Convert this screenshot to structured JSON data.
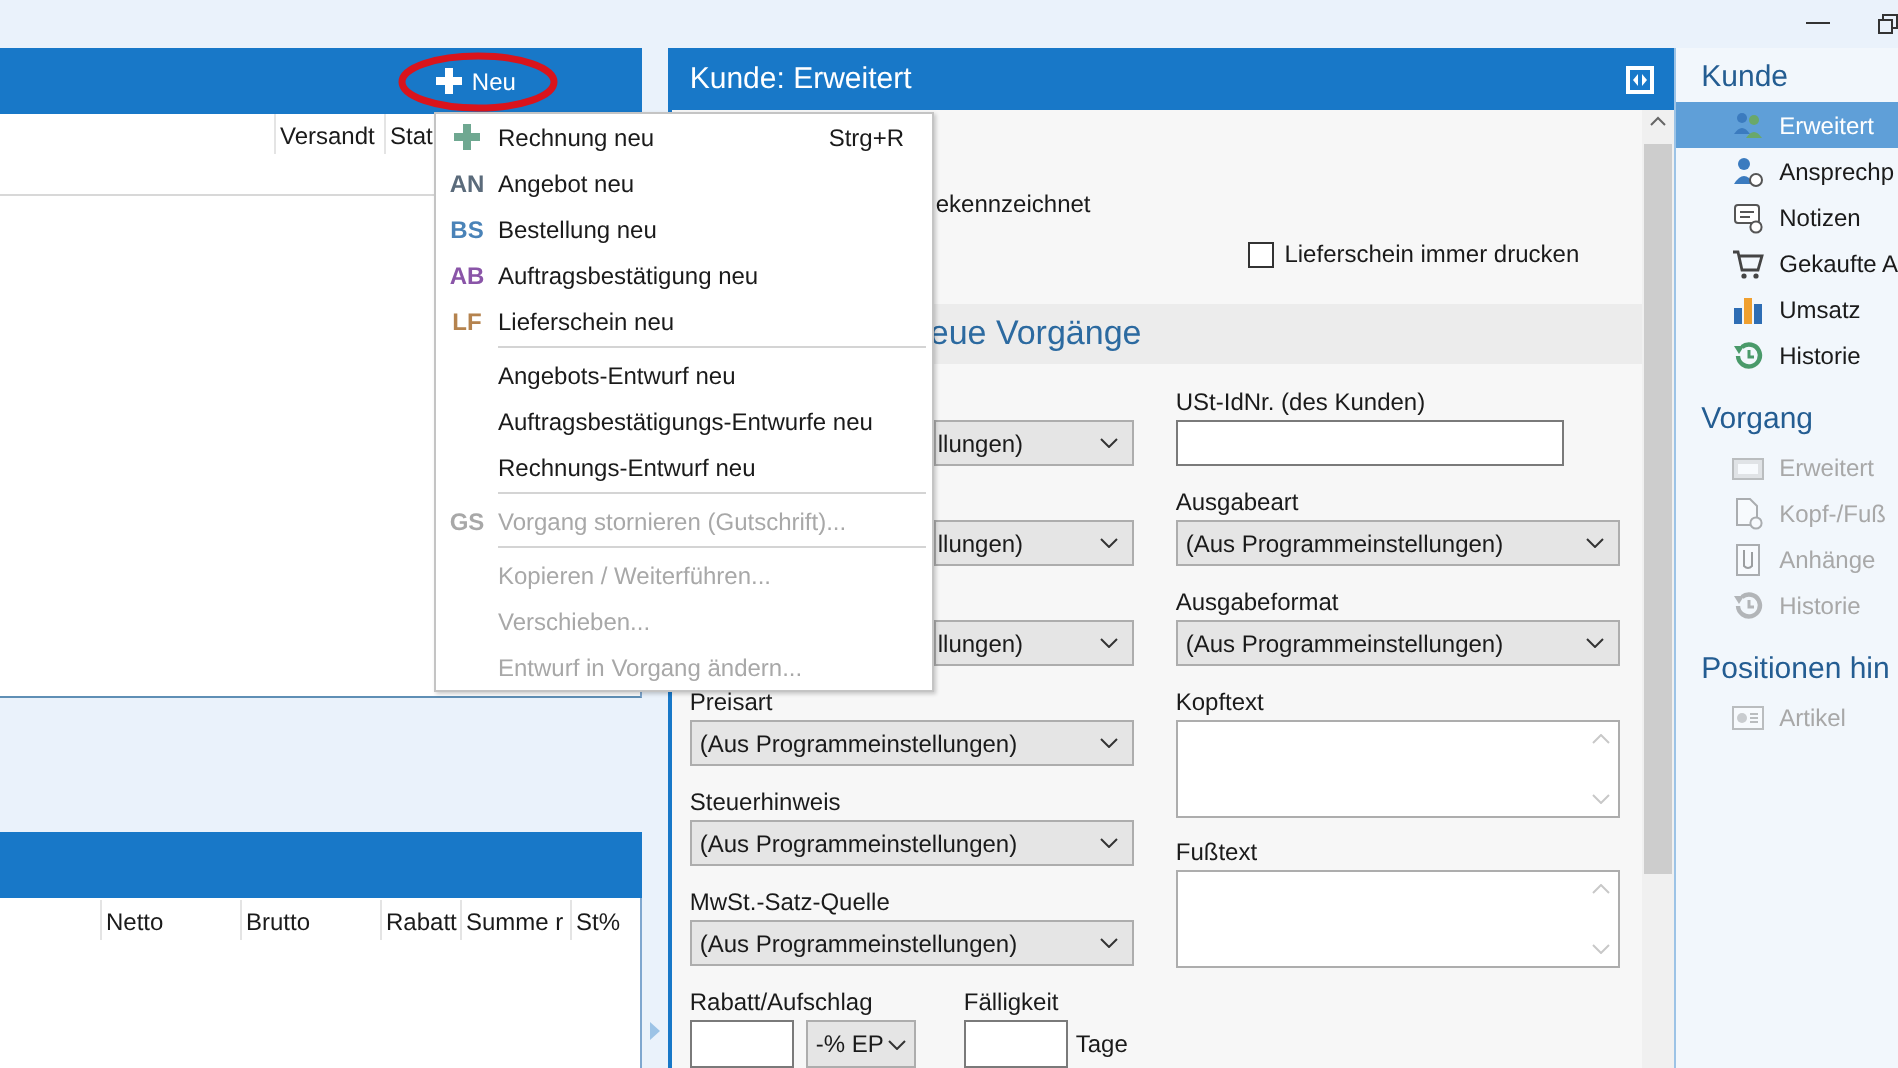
{
  "orders_panel": {
    "new_button": "Neu",
    "columns": [
      "Versandt",
      "Stat"
    ]
  },
  "items_panel": {
    "columns": [
      "Netto",
      "Brutto",
      "Rabatt",
      "Summe r",
      "St%"
    ]
  },
  "new_menu": {
    "items": [
      {
        "kind": "add",
        "label": "Rechnung neu",
        "shortcut": "Strg+R",
        "disabled": false
      },
      {
        "kind": "coded",
        "code": "AN",
        "color": "#5b6b7b",
        "label": "Angebot neu",
        "disabled": false
      },
      {
        "kind": "coded",
        "code": "BS",
        "color": "#4a83b8",
        "label": "Bestellung neu",
        "disabled": false
      },
      {
        "kind": "coded",
        "code": "AB",
        "color": "#8a55a8",
        "label": "Auftragsbestätigung neu",
        "disabled": false
      },
      {
        "kind": "coded",
        "code": "LF",
        "color": "#b5834e",
        "label": "Lieferschein neu",
        "disabled": false
      },
      {
        "kind": "separator"
      },
      {
        "kind": "plain",
        "label": "Angebots-Entwurf neu",
        "disabled": false
      },
      {
        "kind": "plain",
        "label": "Auftragsbestätigungs-Entwurfe neu",
        "disabled": false
      },
      {
        "kind": "plain",
        "label": "Rechnungs-Entwurf neu",
        "disabled": false
      },
      {
        "kind": "separator"
      },
      {
        "kind": "coded",
        "code": "GS",
        "color": "#a8a8a8",
        "label": "Vorgang stornieren (Gutschrift)...",
        "disabled": true
      },
      {
        "kind": "separator"
      },
      {
        "kind": "plain",
        "label": "Kopieren / Weiterführen...",
        "disabled": true
      },
      {
        "kind": "plain",
        "label": "Verschieben...",
        "disabled": true
      },
      {
        "kind": "plain",
        "label": "Entwurf in Vorgang ändern...",
        "disabled": true
      }
    ]
  },
  "detail_panel": {
    "title": "Kunde: Erweitert",
    "partial_text": "ekennzeichnet",
    "checkbox": {
      "label": "Lieferschein immer drucken",
      "checked": false
    },
    "section_title": "eue Vorgänge",
    "left_fields": [
      {
        "value": "llungen)",
        "partial": true
      },
      {
        "value": "llungen)",
        "partial": true
      },
      {
        "value": "llungen)",
        "partial": true
      },
      {
        "label": "Preisart",
        "value": "(Aus Programmeinstellungen)",
        "partial": false
      },
      {
        "label": "Steuerhinweis",
        "value": "(Aus Programmeinstellungen)",
        "partial": false
      },
      {
        "label": "MwSt.-Satz-Quelle",
        "value": "(Aus Programmeinstellungen)",
        "partial": false
      }
    ],
    "discount": {
      "label": "Rabatt/Aufschlag",
      "unit": "-% EP"
    },
    "due": {
      "label": "Fälligkeit",
      "suffix": "Tage"
    },
    "right_fields": [
      {
        "kind": "input",
        "label": "USt-IdNr. (des Kunden)"
      },
      {
        "kind": "select",
        "label": "Ausgabeart",
        "value": "(Aus Programmeinstellungen)"
      },
      {
        "kind": "select",
        "label": "Ausgabeformat",
        "value": "(Aus Programmeinstellungen)"
      },
      {
        "kind": "textarea",
        "label": "Kopftext"
      },
      {
        "kind": "textarea",
        "label": "Fußtext"
      }
    ]
  },
  "sidebar": {
    "groups": [
      {
        "title": "Kunde",
        "items": [
          {
            "label": "Erweitert",
            "selected": true,
            "disabled": false
          },
          {
            "label": "Ansprechp",
            "selected": false,
            "disabled": false
          },
          {
            "label": "Notizen",
            "selected": false,
            "disabled": false
          },
          {
            "label": "Gekaufte A",
            "selected": false,
            "disabled": false
          },
          {
            "label": "Umsatz",
            "selected": false,
            "disabled": false
          },
          {
            "label": "Historie",
            "selected": false,
            "disabled": false
          }
        ]
      },
      {
        "title": "Vorgang",
        "items": [
          {
            "label": "Erweitert",
            "selected": false,
            "disabled": true
          },
          {
            "label": "Kopf-/Fuß",
            "selected": false,
            "disabled": true
          },
          {
            "label": "Anhänge",
            "selected": false,
            "disabled": true
          },
          {
            "label": "Historie",
            "selected": false,
            "disabled": true
          }
        ]
      },
      {
        "title": "Positionen hin",
        "items": [
          {
            "label": "Artikel",
            "selected": false,
            "disabled": true
          }
        ]
      }
    ]
  }
}
